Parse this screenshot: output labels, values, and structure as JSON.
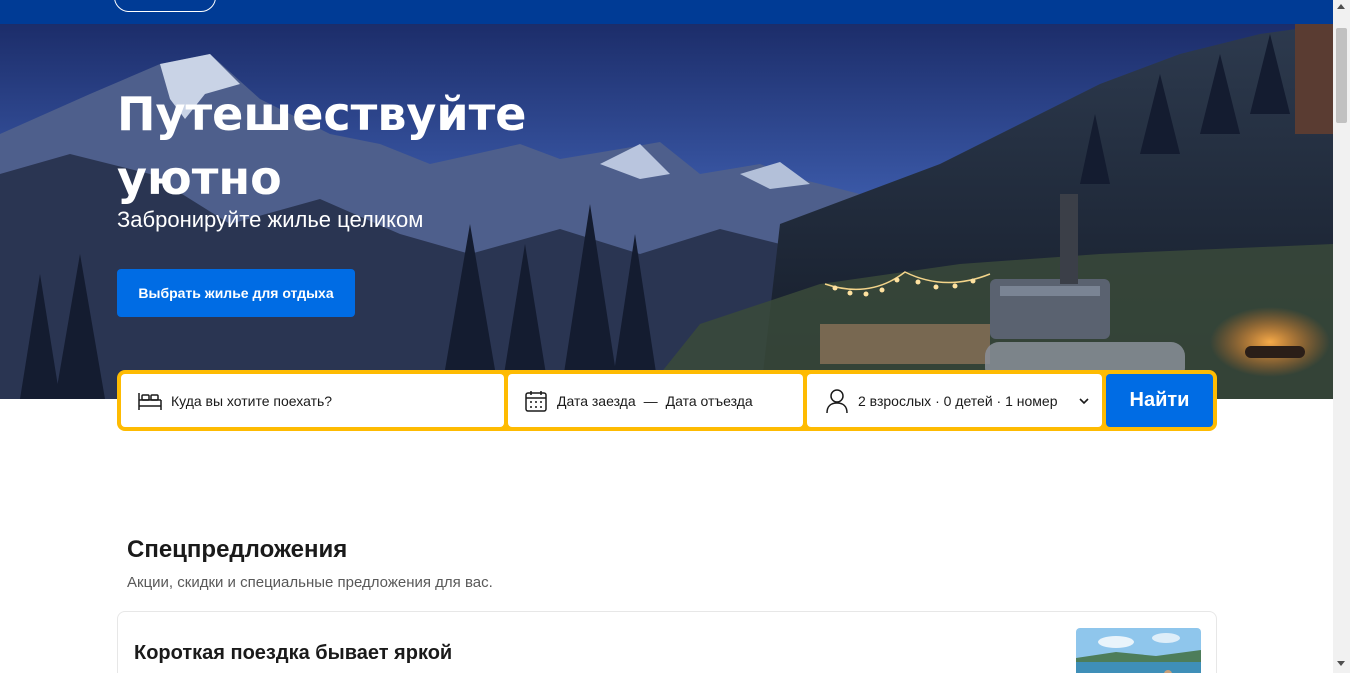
{
  "hero": {
    "title": "Путешествуйте уютно",
    "subtitle": "Забронируйте жилье целиком",
    "cta_label": "Выбрать жилье для отдыха"
  },
  "search": {
    "destination_placeholder": "Куда вы хотите поехать?",
    "checkin_label": "Дата заезда",
    "date_separator": "—",
    "checkout_label": "Дата отъезда",
    "guests_value": "2 взрослых · 0 детей · 1 номер",
    "submit_label": "Найти"
  },
  "deals": {
    "title": "Спецпредложения",
    "subtitle": "Акции, скидки и специальные предложения для вас.",
    "card_title": "Короткая поездка бывает яркой"
  },
  "icons": {
    "destination": "bed-icon",
    "dates": "calendar-icon",
    "guests": "person-icon",
    "dropdown": "chevron-down-icon"
  },
  "colors": {
    "header_blue": "#003b95",
    "primary_blue": "#006ce4",
    "search_border_yellow": "#febb02"
  }
}
